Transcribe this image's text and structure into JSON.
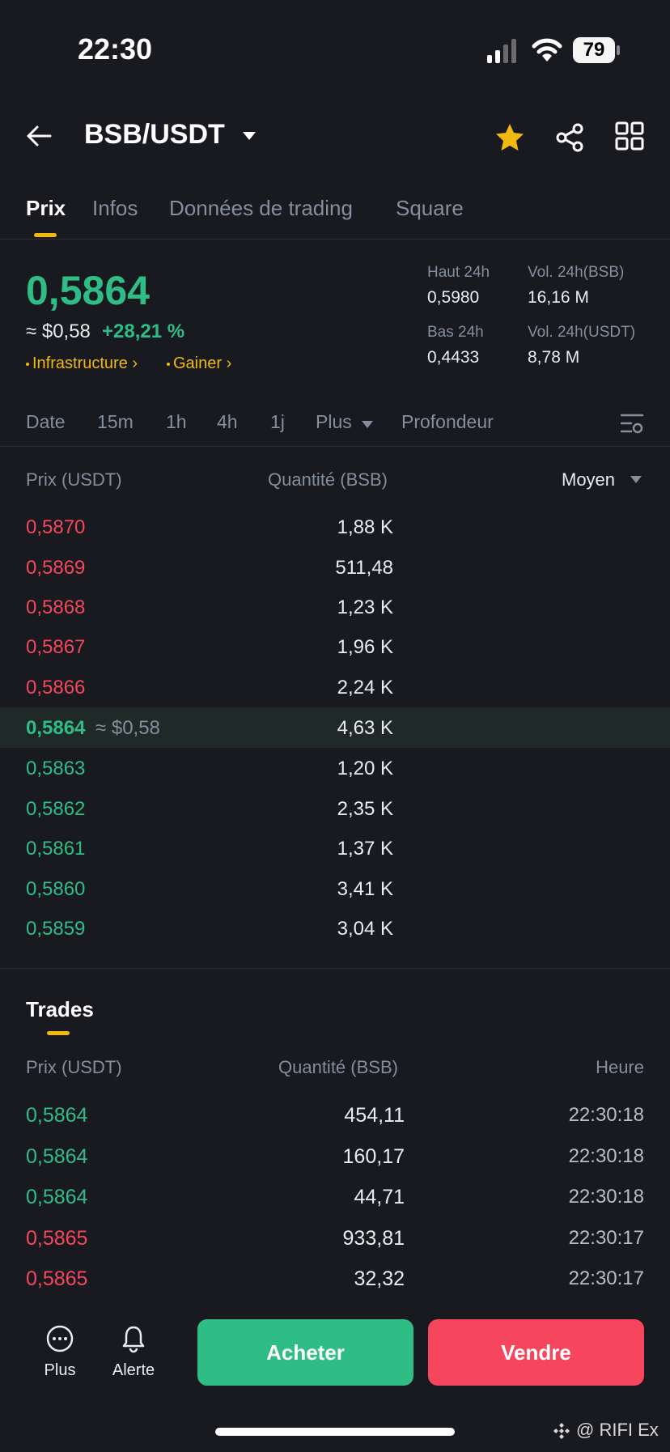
{
  "status": {
    "time": "22:30",
    "battery": "79"
  },
  "header": {
    "pair": "BSB/USDT"
  },
  "tabs": [
    {
      "label": "Prix",
      "active": true
    },
    {
      "label": "Infos"
    },
    {
      "label": "Données de trading"
    },
    {
      "label": "Square"
    }
  ],
  "ticker": {
    "price": "0,5864",
    "usd_approx": "≈ $0,58",
    "change": "+28,21 %",
    "tags": [
      "Infrastructure",
      "Gainer"
    ],
    "stats": {
      "high_label": "Haut 24h",
      "high_value": "0,5980",
      "low_label": "Bas 24h",
      "low_value": "0,4433",
      "vol_bsb_label": "Vol. 24h(BSB)",
      "vol_bsb_value": "16,16 M",
      "vol_usdt_label": "Vol. 24h(USDT)",
      "vol_usdt_value": "8,78 M"
    }
  },
  "intervals": [
    "Date",
    "15m",
    "1h",
    "4h",
    "1j",
    "Plus",
    "Profondeur"
  ],
  "orderbook": {
    "price_header": "Prix (USDT)",
    "qty_header": "Quantité (BSB)",
    "mode": "Moyen",
    "asks": [
      {
        "price": "0,5870",
        "qty": "1,88 K"
      },
      {
        "price": "0,5869",
        "qty": "511,48"
      },
      {
        "price": "0,5868",
        "qty": "1,23 K"
      },
      {
        "price": "0,5867",
        "qty": "1,96 K"
      },
      {
        "price": "0,5866",
        "qty": "2,24 K"
      }
    ],
    "mid": {
      "price": "0,5864",
      "approx": "≈ $0,58",
      "qty": "4,63 K"
    },
    "bids": [
      {
        "price": "0,5863",
        "qty": "1,20 K"
      },
      {
        "price": "0,5862",
        "qty": "2,35 K"
      },
      {
        "price": "0,5861",
        "qty": "1,37 K"
      },
      {
        "price": "0,5860",
        "qty": "3,41 K"
      },
      {
        "price": "0,5859",
        "qty": "3,04 K"
      }
    ]
  },
  "trades": {
    "title": "Trades",
    "price_header": "Prix (USDT)",
    "qty_header": "Quantité (BSB)",
    "time_header": "Heure",
    "rows": [
      {
        "price": "0,5864",
        "qty": "454,11",
        "time": "22:30:18",
        "side": "buy"
      },
      {
        "price": "0,5864",
        "qty": "160,17",
        "time": "22:30:18",
        "side": "buy"
      },
      {
        "price": "0,5864",
        "qty": "44,71",
        "time": "22:30:18",
        "side": "buy"
      },
      {
        "price": "0,5865",
        "qty": "933,81",
        "time": "22:30:17",
        "side": "sell"
      },
      {
        "price": "0,5865",
        "qty": "32,32",
        "time": "22:30:17",
        "side": "sell"
      }
    ]
  },
  "bottom": {
    "more_label": "Plus",
    "alert_label": "Alerte",
    "buy_label": "Acheter",
    "sell_label": "Vendre"
  },
  "watermark": "@ RIFI  Ex",
  "colors": {
    "up": "#2ebd85",
    "down": "#f6465d",
    "accent": "#f0b90b",
    "background": "#181a20"
  },
  "icons": [
    "back-arrow-icon",
    "caret-down-icon",
    "star-icon",
    "share-icon",
    "grid-icon",
    "settings-icon",
    "more-icon",
    "bell-icon",
    "binance-logo-icon"
  ]
}
